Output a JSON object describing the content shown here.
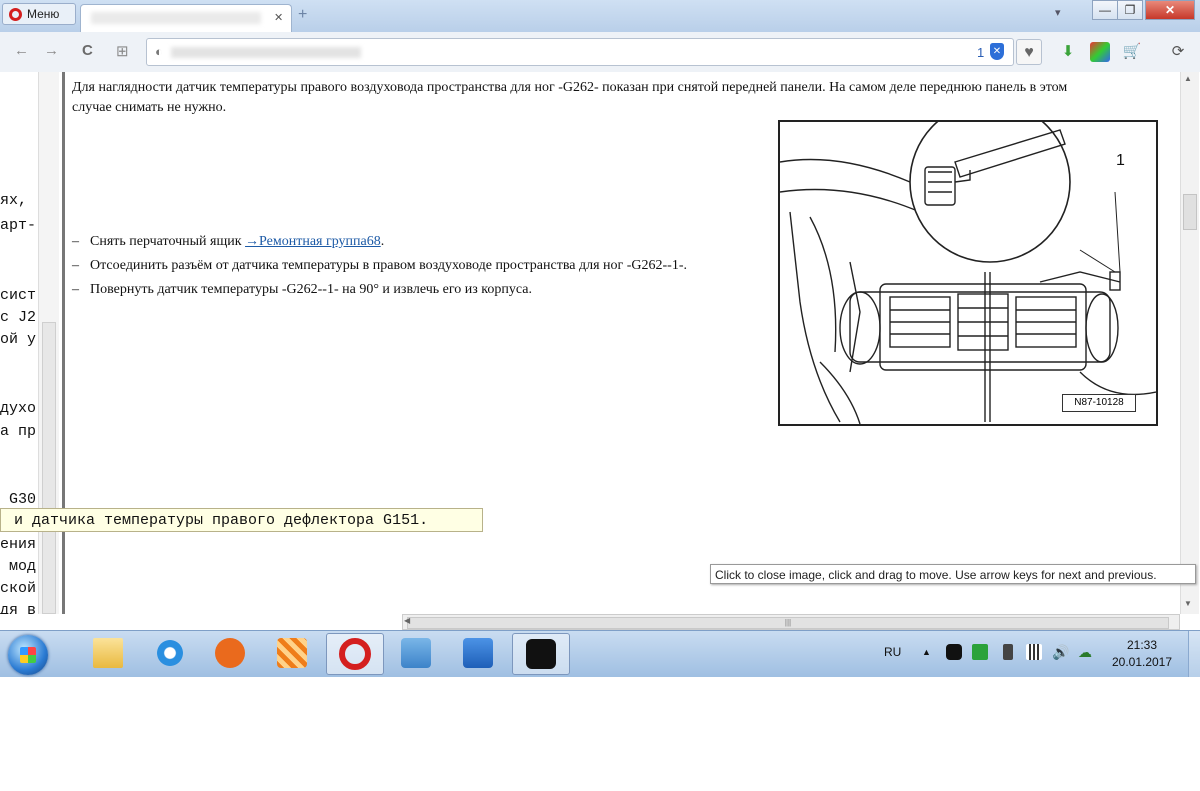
{
  "browser": {
    "menu_label": "Меню",
    "new_tab_symbol": "+",
    "close_tab_symbol": "✕",
    "tab_list_symbol": "▾",
    "window_min": "—",
    "window_max": "❐",
    "window_close": "✕",
    "adblock_count": "1",
    "nav_back": "←",
    "nav_forward": "→",
    "nav_reload": "C",
    "speed_dial": "⊞"
  },
  "left_fragments": [
    "ях,",
    "арт-",
    "сист",
    "с J2",
    "ой у",
    "духо",
    "а пр",
    " G30",
    "ения",
    " мод",
    "ской",
    "дя в"
  ],
  "page": {
    "intro_text": "Для наглядности датчик температуры правого воздуховода пространства для ног -G262- показан при снятой передней панели. На самом деле переднюю панель в этом случае снимать не нужно.",
    "step_dash": "–",
    "steps": {
      "step1_text": "Снять перчаточный ящик ",
      "step1_link": "→Ремонтная группа68",
      "step1_tail": ".",
      "step2_text": "Отсоединить разъём от датчика температуры в правом воздуховоде пространства для ног -G262--1-.",
      "step3_text": "Повернуть датчик температуры -G262--1- на 90° и извлечь его из корпуса."
    },
    "figure": {
      "callout_number": "1",
      "figure_id": "N87-10128"
    },
    "field_overlay_text": " и датчика температуры правого дефлектора G151.",
    "image_hint": "Click to close image, click and drag to move. Use arrow keys for next and previous."
  },
  "scrollbars": {
    "up_arrow": "▲",
    "down_arrow": "▼",
    "left_arrow": "◀",
    "grip": "|||"
  },
  "taskbar": {
    "language": "RU",
    "tray_arrow": "▲",
    "time": "21:33",
    "date": "20.01.2017"
  },
  "colors": {
    "link": "#1c5aa6",
    "opera_red": "#d41f1f",
    "tooltip_bg": "#ffffe4"
  },
  "icons": [
    "opera-icon",
    "back-icon",
    "forward-icon",
    "reload-icon",
    "speed-dial-icon",
    "shield-icon",
    "heart-icon",
    "download-icon",
    "palette-icon",
    "cart-icon",
    "extensions-icon",
    "windows-start-icon"
  ]
}
